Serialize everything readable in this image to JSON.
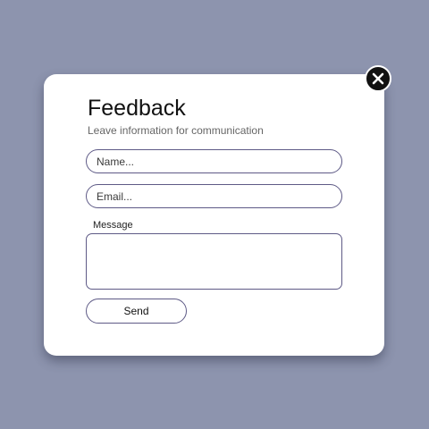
{
  "dialog": {
    "title": "Feedback",
    "subtitle": "Leave information for communication",
    "close_icon": "close-icon"
  },
  "form": {
    "name_placeholder": "Name...",
    "email_placeholder": "Email...",
    "message_label": "Message",
    "message_value": "",
    "send_label": "Send"
  },
  "colors": {
    "page_background": "#8d94ae",
    "card_background": "#ffffff",
    "field_border": "#5e5a86",
    "close_button": "#111111"
  }
}
